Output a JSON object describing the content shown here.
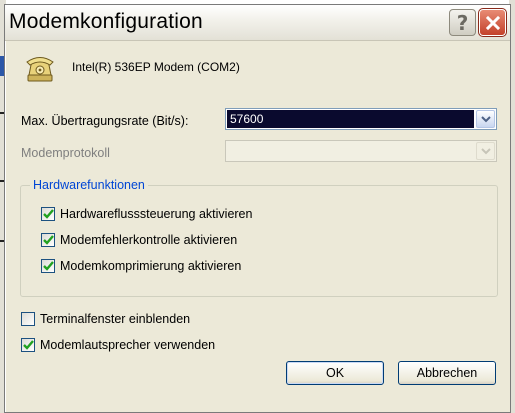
{
  "dialog": {
    "title": "Modemkonfiguration",
    "help_button": "?",
    "close_button": "✕"
  },
  "device": {
    "name": "Intel(R) 536EP Modem (COM2)",
    "icon": "phone-modem-icon"
  },
  "max_rate": {
    "label": "Max. Übertragungsrate (Bit/s):",
    "value": "57600"
  },
  "protocol": {
    "label": "Modemprotokoll",
    "value": ""
  },
  "hardware": {
    "legend": "Hardwarefunktionen",
    "options": [
      {
        "label": "Hardwareflusssteuerung aktivieren",
        "checked": true
      },
      {
        "label": "Modemfehlerkontrolle aktivieren",
        "checked": true
      },
      {
        "label": "Modemkomprimierung aktivieren",
        "checked": true
      }
    ]
  },
  "terminal": {
    "label": "Terminalfenster einblenden",
    "checked": false
  },
  "speaker": {
    "label": "Modemlautsprecher verwenden",
    "checked": true
  },
  "buttons": {
    "ok": "OK",
    "cancel": "Abbrechen"
  },
  "colors": {
    "accent": "#0046d5",
    "checkmark": "#21a121",
    "close_red": "#c3402a",
    "selection": "#0a0a2e"
  }
}
